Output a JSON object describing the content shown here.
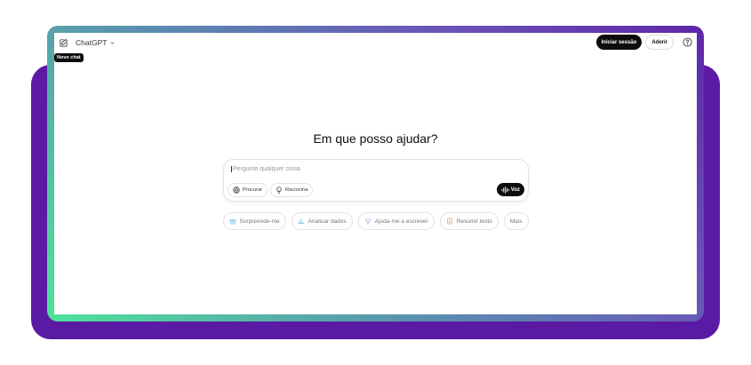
{
  "header": {
    "model_name": "ChatGPT",
    "new_chat_tooltip": "Novo chat",
    "login_label": "Iniciar sessão",
    "signup_label": "Aderir"
  },
  "main": {
    "heading": "Em que posso ajudar?",
    "composer": {
      "placeholder": "Pergunte qualquer coisa",
      "search_label": "Procurar",
      "reason_label": "Raciocina",
      "voice_label": "Voz"
    },
    "suggestions": [
      {
        "label": "Surpreende-me",
        "icon": "gift-icon",
        "color": "#6cb8e8"
      },
      {
        "label": "Analisar dados",
        "icon": "chart-icon",
        "color": "#6cb8e8"
      },
      {
        "label": "Ajuda-me a escrever",
        "icon": "pen-icon",
        "color": "#c58be0"
      },
      {
        "label": "Resumir texto",
        "icon": "document-icon",
        "color": "#e8935a"
      },
      {
        "label": "Mais",
        "icon": "",
        "color": ""
      }
    ]
  },
  "colors": {
    "outer_purple": "#5b1aa3",
    "gradient_green": "#4fe39a",
    "button_dark": "#0d0d0d"
  }
}
